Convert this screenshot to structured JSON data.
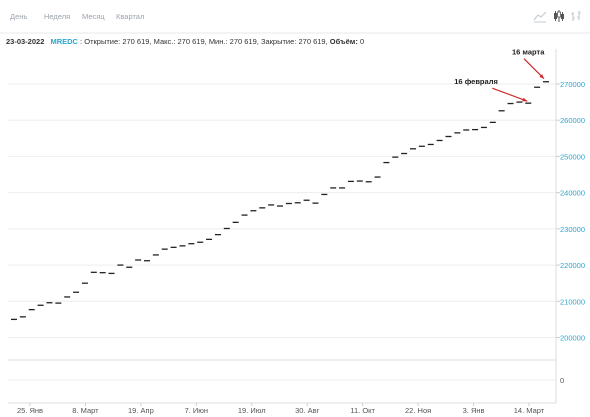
{
  "toolbar": {
    "periods": [
      "День",
      "Неделя",
      "Месяц",
      "Квартал"
    ],
    "active_period": "День",
    "chart_types": [
      "line-chart-icon",
      "candlestick-icon",
      "ohlc-bars-icon"
    ],
    "active_chart_type": "candlestick-icon"
  },
  "info": {
    "date": "23-03-2022",
    "ticker": "MREDC",
    "open_label": "Открытие:",
    "open": "270 619",
    "high_label": "Макс.:",
    "high": "270 619",
    "low_label": "Мин.:",
    "low": "270 619",
    "close_label": "Закрытие:",
    "close": "270 619",
    "volume_label": "Объём:",
    "volume": "0"
  },
  "colors": {
    "background": "#ffffff",
    "ticker": "#2da5cf",
    "price_axis_text": "#2da5cf",
    "grid": "#eeeeee",
    "candles": "#222222",
    "annotation_arrow": "#cc2b2b"
  },
  "chart_data": {
    "type": "candlestick",
    "x_tick_labels": [
      "25. Янв",
      "8. Март",
      "19. Апр",
      "7. Июн",
      "19. Июл",
      "30. Авг",
      "11. Окт",
      "22. Ноя",
      "3. Янв",
      "14. Март"
    ],
    "y_ticks": [
      200000,
      210000,
      220000,
      230000,
      240000,
      250000,
      260000,
      270000
    ],
    "y_tick_labels": [
      "200000",
      "210000",
      "220000",
      "230000",
      "240000",
      "250000",
      "260000",
      "270000"
    ],
    "ylim": [
      196000,
      278000
    ],
    "grid": true,
    "price_series_values": [
      205000,
      205700,
      207700,
      208900,
      209600,
      209500,
      211200,
      212500,
      215000,
      218000,
      217900,
      217700,
      220000,
      219400,
      221400,
      221200,
      222800,
      224400,
      224900,
      225300,
      225900,
      226300,
      227100,
      228400,
      230100,
      231800,
      233800,
      235000,
      235800,
      236600,
      236300,
      237000,
      237200,
      237900,
      237100,
      239500,
      241300,
      241300,
      243100,
      243200,
      243000,
      244300,
      248300,
      249800,
      250800,
      252100,
      252800,
      253300,
      254400,
      255500,
      256500,
      257300,
      257400,
      258000,
      259400,
      262600,
      264600,
      265000,
      264700,
      269100,
      270619
    ],
    "volume_axis_tick": "0",
    "annotations": [
      {
        "text": "16 марта"
      },
      {
        "text": "16 февраля"
      }
    ]
  }
}
